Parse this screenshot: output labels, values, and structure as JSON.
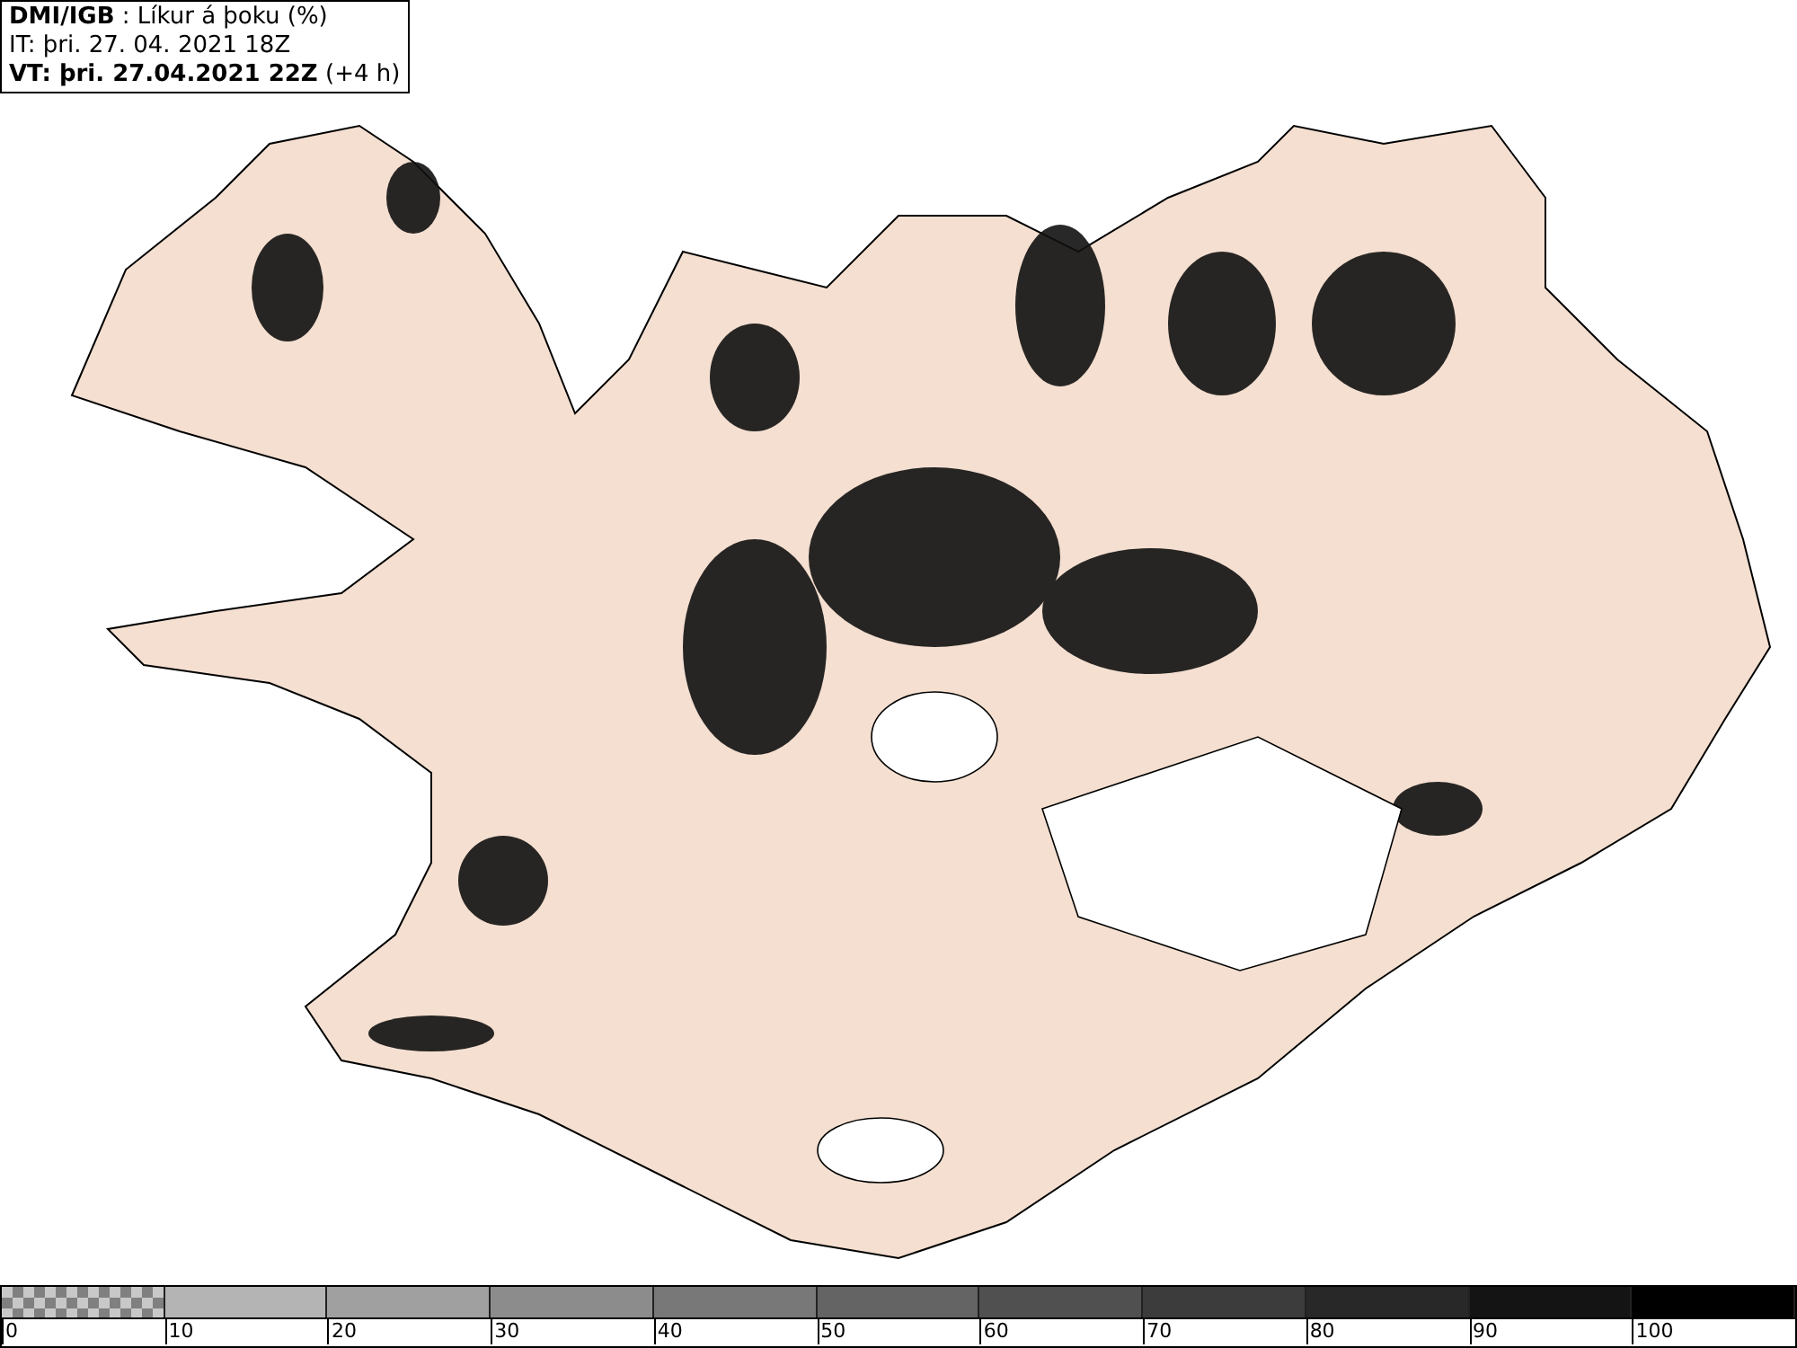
{
  "header": {
    "title": "**DMI/IGB** : Líkur á þoku (%)",
    "issue_time": "IT: þri. 27. 04. 2021 18Z",
    "valid_time": "**VT: þri. 27.04.2021 22Z** (+4 h)"
  },
  "legend": {
    "segments": [
      {
        "kind": "checker",
        "color": "#808080"
      },
      {
        "kind": "solid",
        "color": "#b4b4b4"
      },
      {
        "kind": "solid",
        "color": "#a0a0a0"
      },
      {
        "kind": "solid",
        "color": "#8c8c8c"
      },
      {
        "kind": "solid",
        "color": "#787878"
      },
      {
        "kind": "solid",
        "color": "#646464"
      },
      {
        "kind": "solid",
        "color": "#505050"
      },
      {
        "kind": "solid",
        "color": "#3c3c3c"
      },
      {
        "kind": "solid",
        "color": "#282828"
      },
      {
        "kind": "solid",
        "color": "#141414"
      },
      {
        "kind": "solid",
        "color": "#000000"
      }
    ],
    "ticks": [
      "0",
      "10",
      "20",
      "30",
      "40",
      "50",
      "60",
      "70",
      "80",
      "90",
      "100"
    ]
  }
}
